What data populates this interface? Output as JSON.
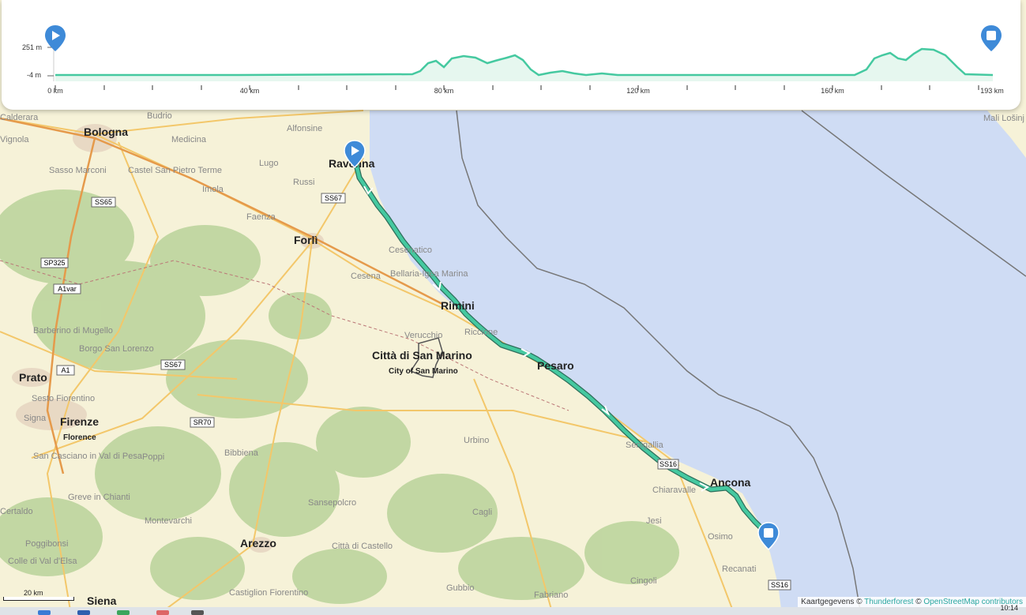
{
  "profile": {
    "y_labels": [
      "251 m",
      "-4 m"
    ],
    "x_labels": [
      "0 km",
      "40 km",
      "80 km",
      "120 km",
      "160 km",
      "193 km"
    ],
    "start_icon": "play-icon",
    "end_icon": "stop-icon",
    "line_color": "#45c9a0"
  },
  "map": {
    "cities": [
      "Bologna",
      "Ravenna",
      "Forlì",
      "Rimini",
      "Città di San Marino",
      "City of San Marino",
      "Pesaro",
      "Ancona",
      "Prato",
      "Firenze",
      "Florence",
      "Arezzo",
      "Siena"
    ],
    "towns": [
      "Budrio",
      "Medicina",
      "Alfonsine",
      "Lugo",
      "Russi",
      "Imola",
      "Faenza",
      "Castel San Pietro Terme",
      "Sasso Marconi",
      "Cesenatico",
      "Cesena",
      "Bellaria-Igea Marina",
      "Verucchio",
      "Riccione",
      "Urbino",
      "Senigallia",
      "Chiaravalle",
      "Jesi",
      "Osimo",
      "Recanati",
      "Cingoli",
      "Fabriano",
      "Gubbio",
      "Città di Castello",
      "Sansepolcro",
      "Bibbiena",
      "Poppi",
      "Montevarchi",
      "Greve in Chianti",
      "San Casciano in Val di Pesa",
      "Borgo San Lorenzo",
      "Barberino di Mugello",
      "Sesto Fiorentino",
      "Signa",
      "Certaldo",
      "Poggibonsi",
      "Colle di Val d'Elsa",
      "Castiglion Fiorentino",
      "Cagli",
      "Mali Lošinj",
      "Calderara",
      "Vignola"
    ],
    "roads": [
      "SS65",
      "SS67",
      "SP325",
      "A1var",
      "A1",
      "SS67",
      "SR70",
      "SS16",
      "SS16"
    ],
    "route_color": "#3bbf9a"
  },
  "scale": {
    "label": "20 km"
  },
  "attribution": {
    "prefix": "Kaartgegevens © ",
    "thunderforest": "Thunderforest",
    "sep": " © ",
    "osm": "OpenStreetMap contributors"
  },
  "taskbar": {
    "time": "10:14"
  }
}
